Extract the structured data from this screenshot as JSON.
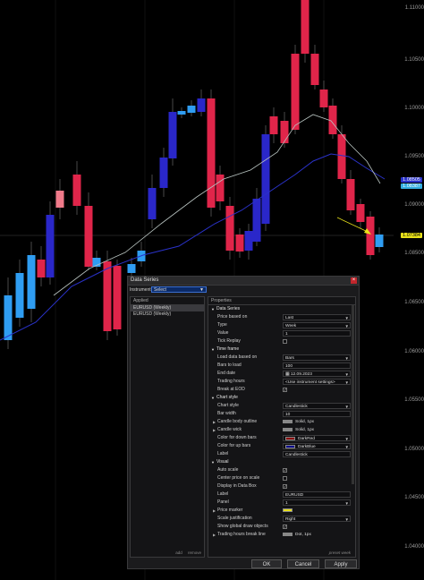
{
  "price_axis": {
    "labels": [
      "1.11000",
      "1.10500",
      "1.10000",
      "1.09500",
      "1.09000",
      "1.08500",
      "1.07500",
      "1.07000",
      "1.06500",
      "1.06000",
      "1.05500",
      "1.05000",
      "1.04500",
      "1.04000",
      "1.03500",
      "1.03000",
      "1.02500",
      "1.02000",
      "1.01500"
    ],
    "tag_blue_1": "1.08505",
    "tag_blue_2": "1.08387",
    "tag_current": "1.07384"
  },
  "colors": {
    "up_bar": "#e0254a",
    "down_bar": "#2a27c9",
    "light_up": "#2f9df2",
    "ma_slow": "#2a32c9",
    "ma_fast": "#b8c3c0",
    "current_tag": "#e8e11a"
  },
  "dialog": {
    "title": "Data Series",
    "close_icon": "×",
    "instrument_label": "Instrument",
    "instrument_value": "Select",
    "applied_header": "Applied",
    "applied_items": [
      "EURUSD (Weekly)",
      "EURUSD (Weekly)"
    ],
    "footer_add": "add",
    "footer_remove": "remove",
    "properties_header": "Properties",
    "data_series_section": "Data Series",
    "price_based_on_label": "Price based on",
    "price_based_on_value": "Last",
    "type_label": "Type",
    "type_value": "Week",
    "value_label": "Value",
    "value_value": "1",
    "tick_replay_label": "Tick Replay",
    "time_frame_section": "Time frame",
    "load_data_label": "Load data based on",
    "load_data_value": "Bars",
    "bars_to_load_label": "Bars to load",
    "bars_to_load_value": "100",
    "end_date_label": "End date",
    "end_date_value": "12.09.2023",
    "trading_hours_label": "Trading hours",
    "trading_hours_value": "<Use instrument settings>",
    "break_eod_label": "Break at EOD",
    "chart_style_section": "Chart style",
    "chart_style_label": "Chart style",
    "chart_style_value": "Candlestick",
    "bar_width_label": "Bar width",
    "bar_width_value": "10",
    "candle_body_label": "Candle body outline",
    "candle_body_value": "Solid, 1px",
    "candle_wick_label": "Candle wick",
    "candle_wick_value": "Solid, 1px",
    "down_color_label": "Color for down bars",
    "down_color_value": "DarkRed",
    "up_color_label": "Color for up bars",
    "up_color_value": "DarkBlue",
    "label_field_label": "Label",
    "label_field_value": "Candlestick",
    "visual_section": "Visual",
    "auto_scale_label": "Auto scale",
    "center_price_label": "Center price on scale",
    "display_databox_label": "Display in Data Box",
    "label2_label": "Label",
    "label2_value": "EURUSD",
    "panel_label": "Panel",
    "panel_value": "1",
    "price_marker_label": "Price marker",
    "scale_just_label": "Scale justification",
    "scale_just_value": "Right",
    "show_global_label": "Show global draw objects",
    "trading_hours_break_label": "Trading hours break line",
    "trading_hours_break_value": "Dot, 1px",
    "preset_label": "preset week",
    "ok_label": "OK",
    "cancel_label": "Cancel",
    "apply_label": "Apply"
  }
}
